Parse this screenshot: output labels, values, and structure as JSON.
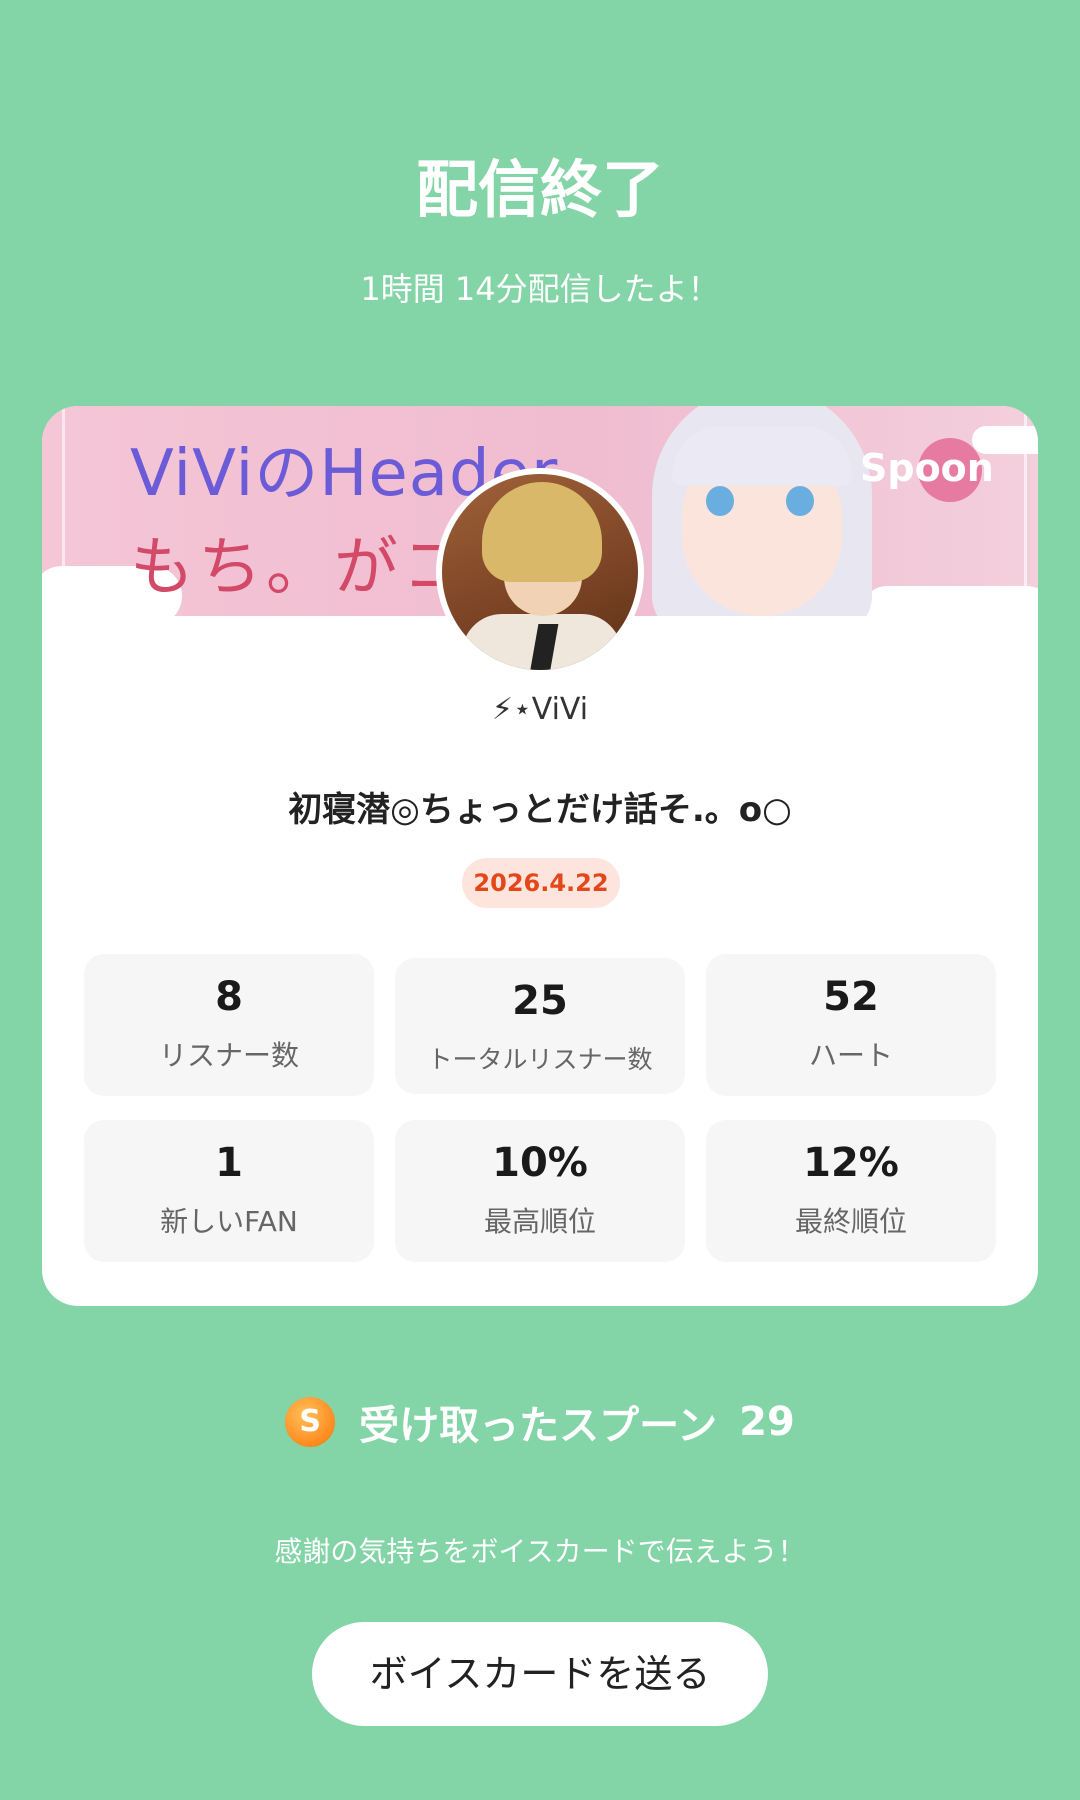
{
  "header": {
    "title": "配信終了",
    "subtitle": "1時間 14分配信したよ！"
  },
  "banner": {
    "text_line_1": "ViViのHeader",
    "text_line_2": "もち。がコ",
    "brand_logo": "Spoon"
  },
  "profile": {
    "username": "⚡︎⋆ViVi",
    "live_title": "初寝潜◎ちょっとだけ話そ.。o○",
    "date": "2026.4.22"
  },
  "stats": [
    {
      "value": "8",
      "label": "リスナー数"
    },
    {
      "value": "25",
      "label": "トータルリスナー数"
    },
    {
      "value": "52",
      "label": "ハート"
    },
    {
      "value": "1",
      "label": "新しいFAN"
    },
    {
      "value": "10%",
      "label": "最高順位"
    },
    {
      "value": "12%",
      "label": "最終順位"
    }
  ],
  "spoons": {
    "icon_letter": "S",
    "label": "受け取ったスプーン",
    "count": "29"
  },
  "footer": {
    "thanks_text": "感謝の気持ちをボイスカードで伝えよう！",
    "voice_card_button": "ボイスカードを送る"
  },
  "colors": {
    "background": "#83d4a6",
    "date_badge_text": "#e4471a",
    "date_badge_bg": "#fde4dc"
  }
}
